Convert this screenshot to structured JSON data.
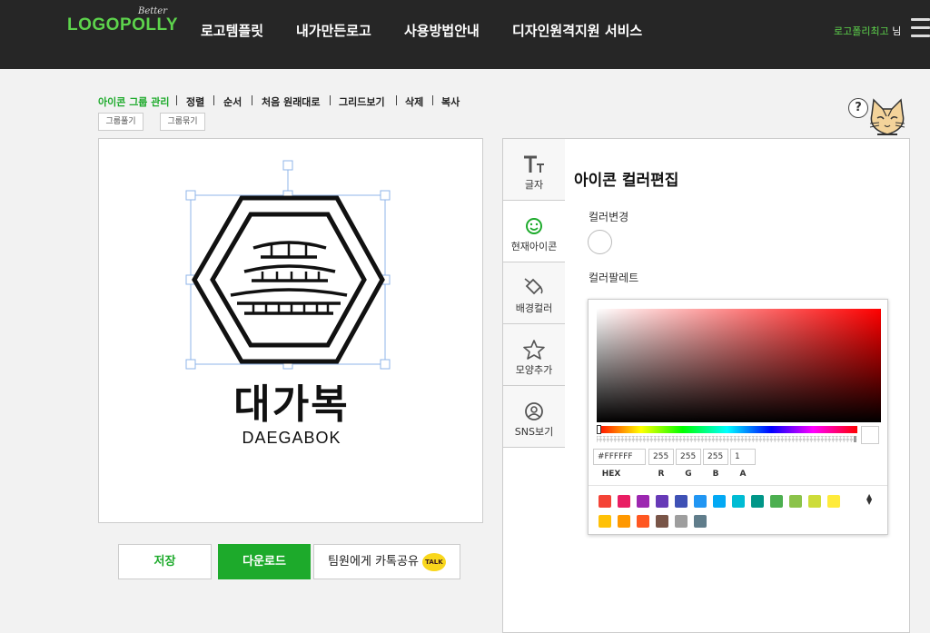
{
  "header": {
    "logo_better": "Better",
    "logo_text": "LOGOPOLLY",
    "nav": [
      "로고템플릿",
      "내가만든로고",
      "사용방법안내",
      "디자인원격지원 서비스"
    ],
    "user_name": "로고폴리최고",
    "user_suffix": "님"
  },
  "toolbar": {
    "items": [
      "아이콘 그룹 관리",
      "정렬",
      "순서",
      "처음 원래대로",
      "그리드보기",
      "삭제",
      "복사"
    ],
    "group_button": "그룹풀기",
    "ungroup_button": "그룹묶기"
  },
  "help": "?",
  "canvas": {
    "brand_name": "대가복",
    "brand_sub": "DAEGABOK"
  },
  "actions": {
    "save": "저장",
    "download": "다운로드",
    "share": "팀원에게 카톡공유",
    "talk_badge": "TALK"
  },
  "side_tabs": [
    {
      "label": "글자",
      "icon": "text-icon"
    },
    {
      "label": "현재아이콘",
      "icon": "smiley-icon"
    },
    {
      "label": "배경컬러",
      "icon": "paint-bucket-icon"
    },
    {
      "label": "모양추가",
      "icon": "star-icon"
    },
    {
      "label": "SNS보기",
      "icon": "profile-icon"
    }
  ],
  "editor": {
    "title": "아이콘 컬러편집",
    "color_change_label": "컬러변경",
    "palette_label": "컬러팔레트"
  },
  "picker": {
    "hex": "#FFFFFF",
    "r": "255",
    "g": "255",
    "b": "255",
    "a": "1",
    "labels": {
      "hex": "HEX",
      "r": "R",
      "g": "G",
      "b": "B",
      "a": "A"
    },
    "palette": [
      "#f44336",
      "#e91e63",
      "#9c27b0",
      "#673ab7",
      "#3f51b5",
      "#2196f3",
      "#03a9f4",
      "#00bcd4",
      "#009688",
      "#4caf50",
      "#8bc34a",
      "#cddc39",
      "#ffeb3b",
      "#ffc107",
      "#ff9800",
      "#ff5722",
      "#795548",
      "#9e9e9e",
      "#607d8b"
    ]
  },
  "colors": {
    "accent": "#1daa2b",
    "header_bg": "#262626"
  }
}
